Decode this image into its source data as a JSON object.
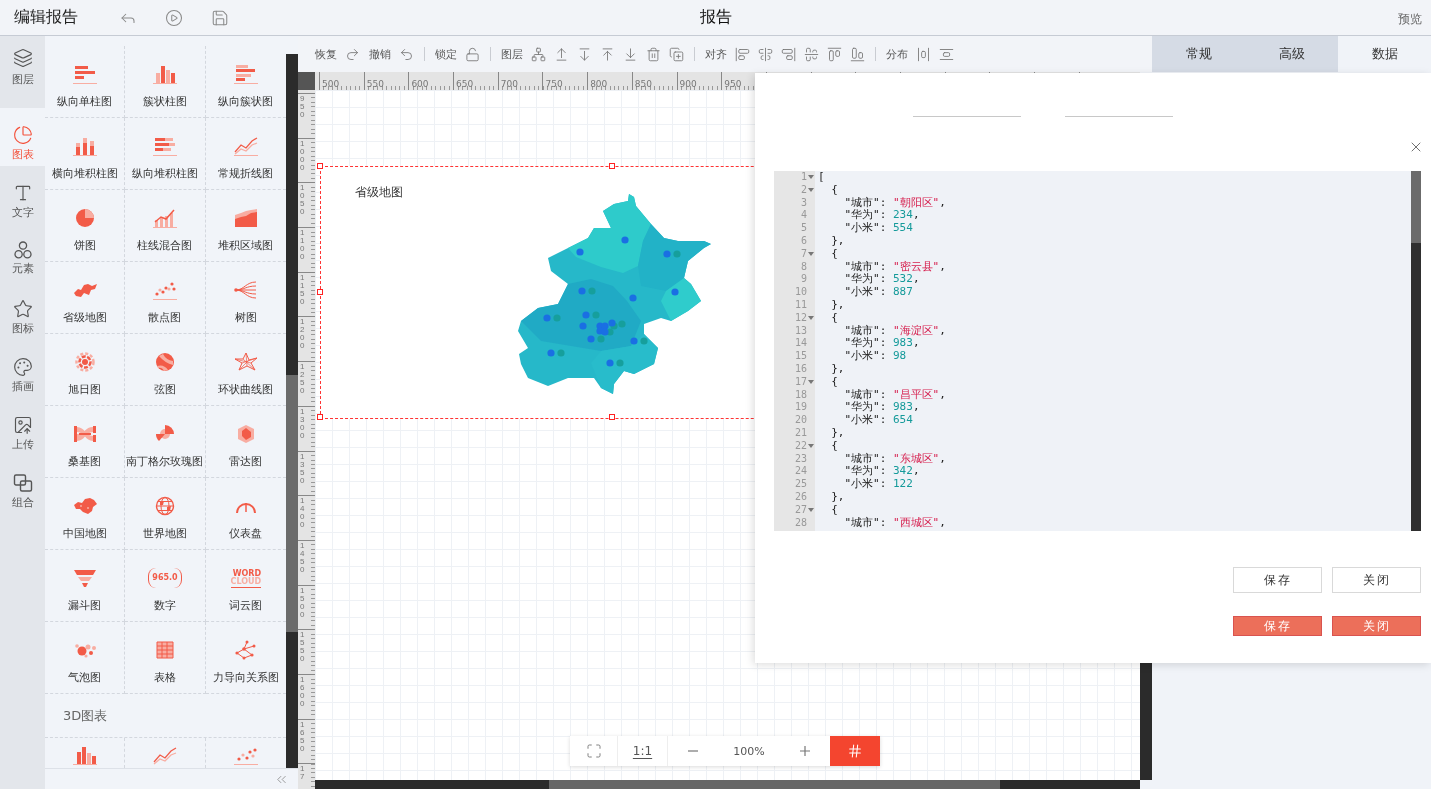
{
  "top_bar": {
    "title": "编辑报告",
    "center_title": "报告",
    "preview": "预览"
  },
  "rail": {
    "items": [
      {
        "label": "图层",
        "kind": "layers",
        "selected": false
      },
      {
        "label": "图表",
        "kind": "chart",
        "selected": true
      },
      {
        "label": "文字",
        "kind": "text",
        "selected": false
      },
      {
        "label": "元素",
        "kind": "elements",
        "selected": false
      },
      {
        "label": "图标",
        "kind": "icons",
        "selected": false
      },
      {
        "label": "插画",
        "kind": "illustration",
        "selected": false
      },
      {
        "label": "上传",
        "kind": "upload",
        "selected": false
      },
      {
        "label": "组合",
        "kind": "group",
        "selected": false
      }
    ]
  },
  "palette": {
    "sections": [
      {
        "rows": [
          [
            {
              "label": "纵向单柱图",
              "kind": "hbar"
            },
            {
              "label": "簇状柱图",
              "kind": "cluster"
            },
            {
              "label": "纵向簇状图",
              "kind": "hcluster"
            }
          ],
          [
            {
              "label": "横向堆积柱图",
              "kind": "stacked-col"
            },
            {
              "label": "纵向堆积柱图",
              "kind": "stacked-bar"
            },
            {
              "label": "常规折线图",
              "kind": "line"
            }
          ],
          [
            {
              "label": "饼图",
              "kind": "pie"
            },
            {
              "label": "柱线混合图",
              "kind": "bar-line"
            },
            {
              "label": "堆积区域图",
              "kind": "area"
            }
          ],
          [
            {
              "label": "省级地图",
              "kind": "province-map"
            },
            {
              "label": "散点图",
              "kind": "scatter"
            },
            {
              "label": "树图",
              "kind": "tree"
            }
          ],
          [
            {
              "label": "旭日图",
              "kind": "sunburst"
            },
            {
              "label": "弦图",
              "kind": "chord"
            },
            {
              "label": "环状曲线图",
              "kind": "radial-line"
            }
          ],
          [
            {
              "label": "桑基图",
              "kind": "sankey"
            },
            {
              "label": "南丁格尔玫瑰图",
              "kind": "rose"
            },
            {
              "label": "雷达图",
              "kind": "radar"
            }
          ],
          [
            {
              "label": "中国地图",
              "kind": "china-map"
            },
            {
              "label": "世界地图",
              "kind": "world-map"
            },
            {
              "label": "仪表盘",
              "kind": "gauge"
            }
          ],
          [
            {
              "label": "漏斗图",
              "kind": "funnel"
            },
            {
              "label": "数字",
              "kind": "number",
              "icon_text": [
                "965.0"
              ]
            },
            {
              "label": "词云图",
              "kind": "wordcloud",
              "icon_text": [
                "WORD",
                "CLOUD"
              ]
            }
          ],
          [
            {
              "label": "气泡图",
              "kind": "bubble"
            },
            {
              "label": "表格",
              "kind": "table"
            },
            {
              "label": "力导向关系图",
              "kind": "graph"
            }
          ]
        ]
      },
      {
        "title": "3D图表",
        "rows": [
          [
            {
              "kind": "bar3d"
            },
            {
              "kind": "line3d"
            },
            {
              "kind": "scatter3d"
            }
          ]
        ]
      }
    ]
  },
  "toolbar": {
    "sections": [
      [
        {
          "label": "恢复",
          "buttons": [
            {
              "kind": "redo"
            }
          ]
        },
        {
          "label": "撤销",
          "buttons": [
            {
              "kind": "undo"
            }
          ]
        }
      ],
      [
        {
          "label": "锁定",
          "buttons": [
            {
              "kind": "unlock"
            }
          ]
        }
      ],
      [
        {
          "label": "图层",
          "buttons": [
            {
              "kind": "hierarchy"
            },
            {
              "kind": "bring-forward"
            },
            {
              "kind": "send-backward"
            },
            {
              "kind": "bring-to-front"
            },
            {
              "kind": "send-to-back"
            },
            {
              "kind": "delete"
            },
            {
              "kind": "duplicate"
            }
          ]
        }
      ],
      [
        {
          "label": "对齐",
          "buttons": [
            {
              "kind": "align-left"
            },
            {
              "kind": "align-center"
            },
            {
              "kind": "align-right"
            },
            {
              "kind": "align-middle"
            },
            {
              "kind": "align-top"
            },
            {
              "kind": "align-bottom"
            }
          ]
        }
      ],
      [
        {
          "label": "分布",
          "buttons": [
            {
              "kind": "distribute-horizontal"
            },
            {
              "kind": "distribute-vertical"
            }
          ]
        }
      ]
    ]
  },
  "ruler": {
    "horizontal": [
      "500",
      "550",
      "600",
      "650",
      "700",
      "750",
      "800",
      "850",
      "900",
      "950"
    ],
    "vertical": [
      "950",
      "1000",
      "1050",
      "1100",
      "1150",
      "1200",
      "1250",
      "1300",
      "1350",
      "1400",
      "1450",
      "1500",
      "1550",
      "1600",
      "1650",
      "17"
    ]
  },
  "widget": {
    "title": "省级地图"
  },
  "zoom_bar": {
    "ratio": "1:1",
    "zoom": "100%",
    "grid_on": true
  },
  "panel_tabs": [
    {
      "label": "常规",
      "selected": false
    },
    {
      "label": "高级",
      "selected": false
    },
    {
      "label": "数据",
      "selected": true
    }
  ],
  "dialog": {
    "editor": {
      "lines": [
        {
          "no": "1",
          "text": "[",
          "fold": true
        },
        {
          "no": "2",
          "text": "  {",
          "fold": true
        },
        {
          "no": "3",
          "text": "    \"城市\": \"朝阳区\",",
          "fold": false
        },
        {
          "no": "4",
          "text": "    \"华为\": 234,",
          "fold": false
        },
        {
          "no": "5",
          "text": "    \"小米\": 554",
          "fold": false
        },
        {
          "no": "6",
          "text": "  },",
          "fold": false
        },
        {
          "no": "7",
          "text": "  {",
          "fold": true
        },
        {
          "no": "8",
          "text": "    \"城市\": \"密云县\",",
          "fold": false
        },
        {
          "no": "9",
          "text": "    \"华为\": 532,",
          "fold": false
        },
        {
          "no": "10",
          "text": "    \"小米\": 887",
          "fold": false
        },
        {
          "no": "11",
          "text": "  },",
          "fold": false
        },
        {
          "no": "12",
          "text": "  {",
          "fold": true
        },
        {
          "no": "13",
          "text": "    \"城市\": \"海淀区\",",
          "fold": false
        },
        {
          "no": "14",
          "text": "    \"华为\": 983,",
          "fold": false
        },
        {
          "no": "15",
          "text": "    \"小米\": 98",
          "fold": false
        },
        {
          "no": "16",
          "text": "  },",
          "fold": false
        },
        {
          "no": "17",
          "text": "  {",
          "fold": true
        },
        {
          "no": "18",
          "text": "    \"城市\": \"昌平区\",",
          "fold": false
        },
        {
          "no": "19",
          "text": "    \"华为\": 983,",
          "fold": false
        },
        {
          "no": "20",
          "text": "    \"小米\": 654",
          "fold": false
        },
        {
          "no": "21",
          "text": "  },",
          "fold": false
        },
        {
          "no": "22",
          "text": "  {",
          "fold": true
        },
        {
          "no": "23",
          "text": "    \"城市\": \"东城区\",",
          "fold": false
        },
        {
          "no": "24",
          "text": "    \"华为\": 342,",
          "fold": false
        },
        {
          "no": "25",
          "text": "    \"小米\": 122",
          "fold": false
        },
        {
          "no": "26",
          "text": "  },",
          "fold": false
        },
        {
          "no": "27",
          "text": "  {",
          "fold": true
        },
        {
          "no": "28",
          "text": "    \"城市\": \"西城区\",",
          "fold": false
        }
      ]
    },
    "button_rows": [
      [
        {
          "label": "保存",
          "kind": "default"
        },
        {
          "label": "关闭",
          "kind": "default"
        }
      ],
      [
        {
          "label": "保存",
          "kind": "primary"
        },
        {
          "label": "关闭",
          "kind": "primary"
        }
      ]
    ]
  }
}
